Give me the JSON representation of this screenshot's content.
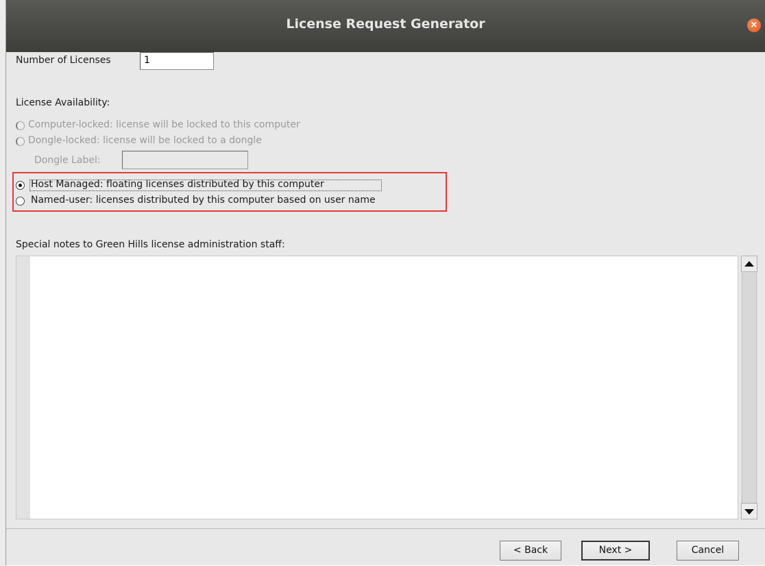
{
  "window": {
    "title": "License Request Generator",
    "close_glyph": "×"
  },
  "licenses": {
    "count_label": "Number of Licenses",
    "count_value": "1"
  },
  "availability": {
    "heading": "License Availability:",
    "options": [
      {
        "label": "Computer-locked: license will be locked to this computer",
        "state": "disabled"
      },
      {
        "label": "Dongle-locked: license will be locked to a dongle",
        "state": "disabled"
      },
      {
        "label": "Host Managed: floating licenses distributed by this computer",
        "state": "selected"
      },
      {
        "label": "Named-user: licenses distributed by this computer based on user name",
        "state": "unselected"
      }
    ],
    "dongle_label": "Dongle Label:",
    "dongle_value": ""
  },
  "notes": {
    "label": "Special notes to Green Hills license administration staff:",
    "value": ""
  },
  "buttons": {
    "back": "< Back",
    "next": "Next >",
    "cancel": "Cancel"
  },
  "colors": {
    "highlight": "#e23b3b",
    "title_bar": "#4a4a47",
    "close_button": "#e8643a"
  }
}
